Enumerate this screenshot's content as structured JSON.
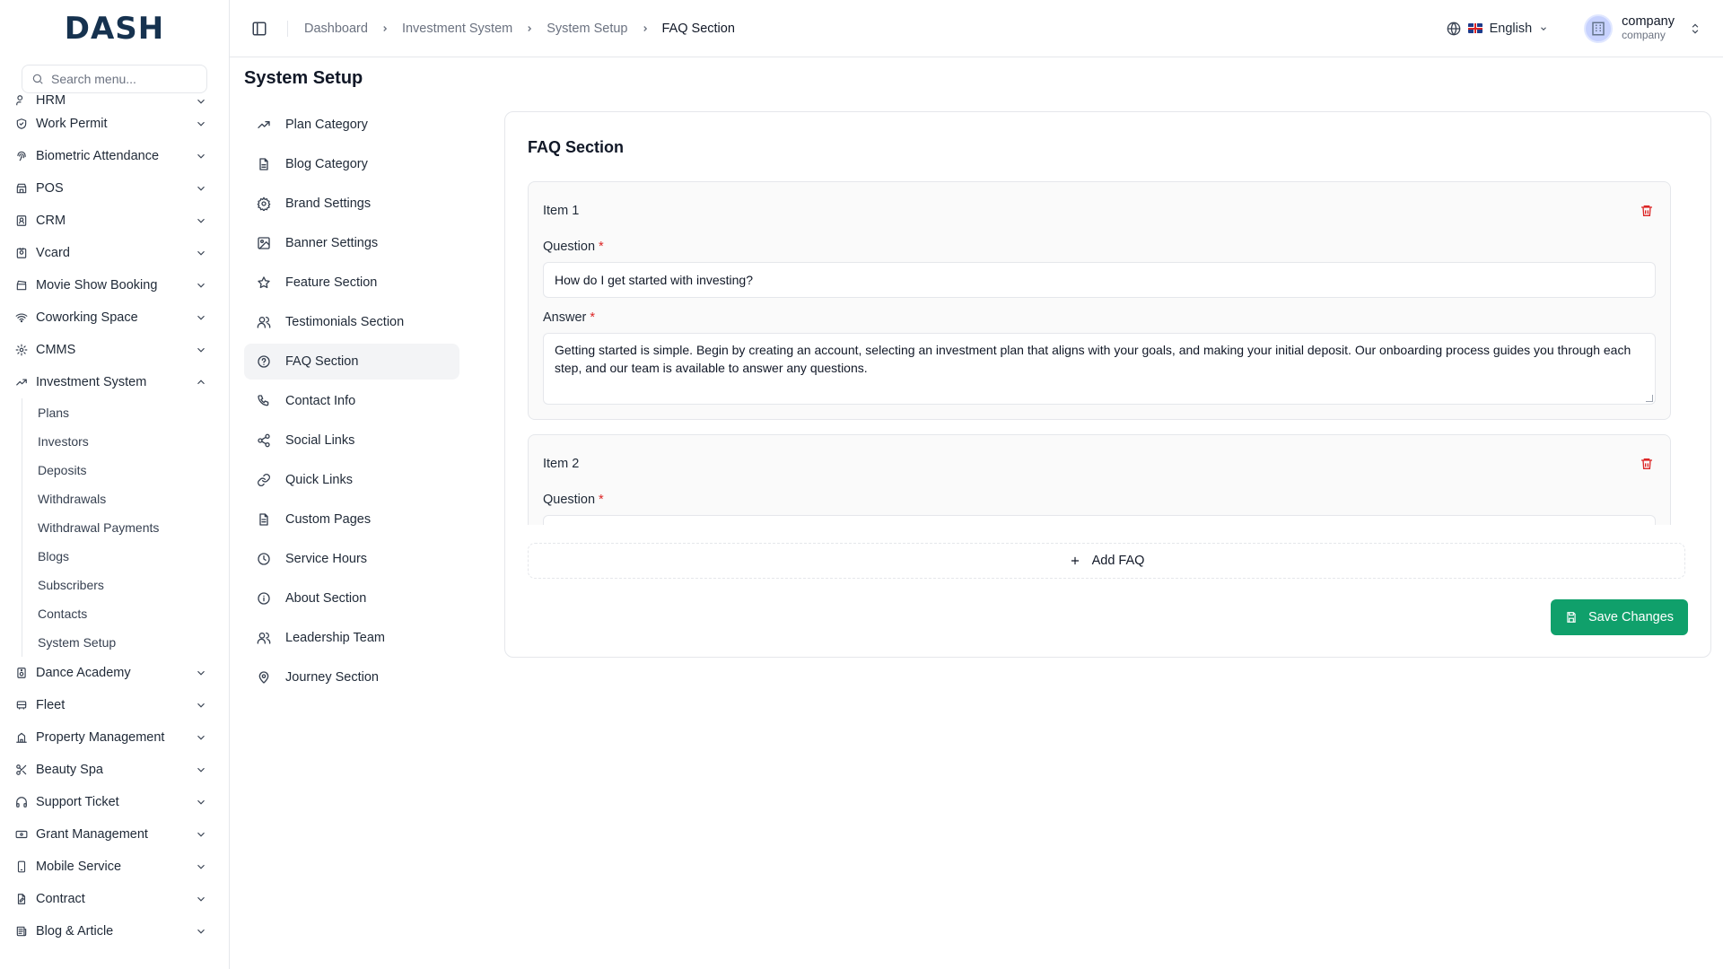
{
  "brand": {
    "logo_text": "DASH"
  },
  "search": {
    "placeholder": "Search menu..."
  },
  "sidebar": {
    "partial_item": "HRM",
    "items": [
      {
        "label": "Work Permit",
        "icon": "shield-check-icon"
      },
      {
        "label": "Biometric Attendance",
        "icon": "fingerprint-icon"
      },
      {
        "label": "POS",
        "icon": "store-icon"
      },
      {
        "label": "CRM",
        "icon": "contact-icon"
      },
      {
        "label": "Vcard",
        "icon": "badge-icon"
      },
      {
        "label": "Movie Show Booking",
        "icon": "clapperboard-icon"
      },
      {
        "label": "Coworking Space",
        "icon": "wifi-icon"
      },
      {
        "label": "CMMS",
        "icon": "cog-icon"
      },
      {
        "label": "Investment System",
        "icon": "trending-up-icon"
      }
    ],
    "sub_items": [
      "Plans",
      "Investors",
      "Deposits",
      "Withdrawals",
      "Withdrawal Payments",
      "Blogs",
      "Subscribers",
      "Contacts",
      "System Setup"
    ],
    "items_after": [
      {
        "label": "Dance Academy",
        "icon": "speaker-icon"
      },
      {
        "label": "Fleet",
        "icon": "bus-icon"
      },
      {
        "label": "Property Management",
        "icon": "building-icon"
      },
      {
        "label": "Beauty Spa",
        "icon": "scissors-icon"
      },
      {
        "label": "Support Ticket",
        "icon": "headphones-icon"
      },
      {
        "label": "Grant Management",
        "icon": "banknote-icon"
      },
      {
        "label": "Mobile Service",
        "icon": "smartphone-icon"
      },
      {
        "label": "Contract",
        "icon": "file-pen-icon"
      },
      {
        "label": "Blog & Article",
        "icon": "newspaper-icon"
      }
    ]
  },
  "breadcrumb": [
    "Dashboard",
    "Investment System",
    "System Setup",
    "FAQ Section"
  ],
  "header": {
    "language": "English",
    "user_name": "company",
    "user_role": "company"
  },
  "page": {
    "title": "System Setup"
  },
  "settings_nav": [
    {
      "label": "Plan Category",
      "icon": "trending-up-icon"
    },
    {
      "label": "Blog Category",
      "icon": "file-text-icon"
    },
    {
      "label": "Brand Settings",
      "icon": "settings-icon"
    },
    {
      "label": "Banner Settings",
      "icon": "image-icon"
    },
    {
      "label": "Feature Section",
      "icon": "star-icon"
    },
    {
      "label": "Testimonials Section",
      "icon": "users-icon"
    },
    {
      "label": "FAQ Section",
      "icon": "help-circle-icon",
      "active": true
    },
    {
      "label": "Contact Info",
      "icon": "phone-icon"
    },
    {
      "label": "Social Links",
      "icon": "share-icon"
    },
    {
      "label": "Quick Links",
      "icon": "link-icon"
    },
    {
      "label": "Custom Pages",
      "icon": "file-icon"
    },
    {
      "label": "Service Hours",
      "icon": "clock-icon"
    },
    {
      "label": "About Section",
      "icon": "info-icon"
    },
    {
      "label": "Leadership Team",
      "icon": "users-icon"
    },
    {
      "label": "Journey Section",
      "icon": "map-pin-icon"
    }
  ],
  "faq": {
    "title": "FAQ Section",
    "question_label": "Question",
    "answer_label": "Answer",
    "required_mark": "*",
    "items": [
      {
        "label": "Item 1",
        "question": "How do I get started with investing?",
        "answer": "Getting started is simple. Begin by creating an account, selecting an investment plan that aligns with your goals, and making your initial deposit. Our onboarding process guides you through each step, and our team is available to answer any questions."
      },
      {
        "label": "Item 2"
      }
    ],
    "add_label": "Add FAQ",
    "save_label": "Save Changes"
  },
  "colors": {
    "primary": "#10a06b",
    "danger": "#dc2626",
    "brand": "#16324f"
  }
}
